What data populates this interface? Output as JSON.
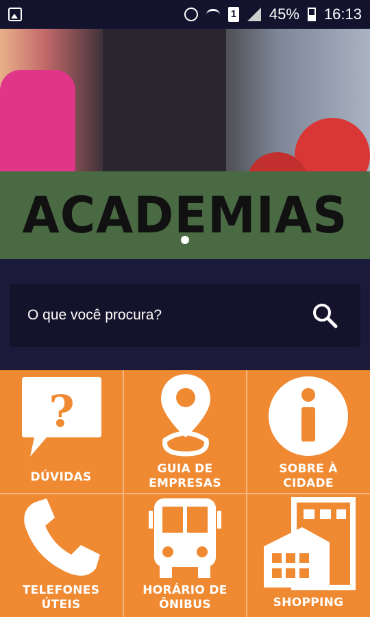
{
  "status_bar": {
    "battery": "45%",
    "time": "16:13",
    "sim_slot": "1",
    "icons": [
      "gallery-icon",
      "alarm-icon",
      "wifi-icon",
      "sim-icon",
      "signal-icon",
      "battery-icon"
    ]
  },
  "banner": {
    "title": "ACADEMIAS"
  },
  "search": {
    "placeholder": "O que você procura?"
  },
  "menu": [
    {
      "label_line1": "DÚVIDAS",
      "label_line2": "",
      "icon": "question-bubble-icon"
    },
    {
      "label_line1": "GUIA DE",
      "label_line2": "EMPRESAS",
      "icon": "map-pin-icon"
    },
    {
      "label_line1": "SOBRE À",
      "label_line2": "CIDADE",
      "icon": "info-icon"
    },
    {
      "label_line1": "TELEFONES",
      "label_line2": "ÚTEIS",
      "icon": "phone-icon"
    },
    {
      "label_line1": "HORÁRIO DE",
      "label_line2": "ÔNIBUS",
      "icon": "bus-icon"
    },
    {
      "label_line1": "SHOPPING",
      "label_line2": "",
      "icon": "buildings-icon"
    }
  ],
  "colors": {
    "status_bar": "#14132e",
    "banner": "#4a6a44",
    "menu_tiles": "#f08a32",
    "search_bg": "#14132b"
  }
}
